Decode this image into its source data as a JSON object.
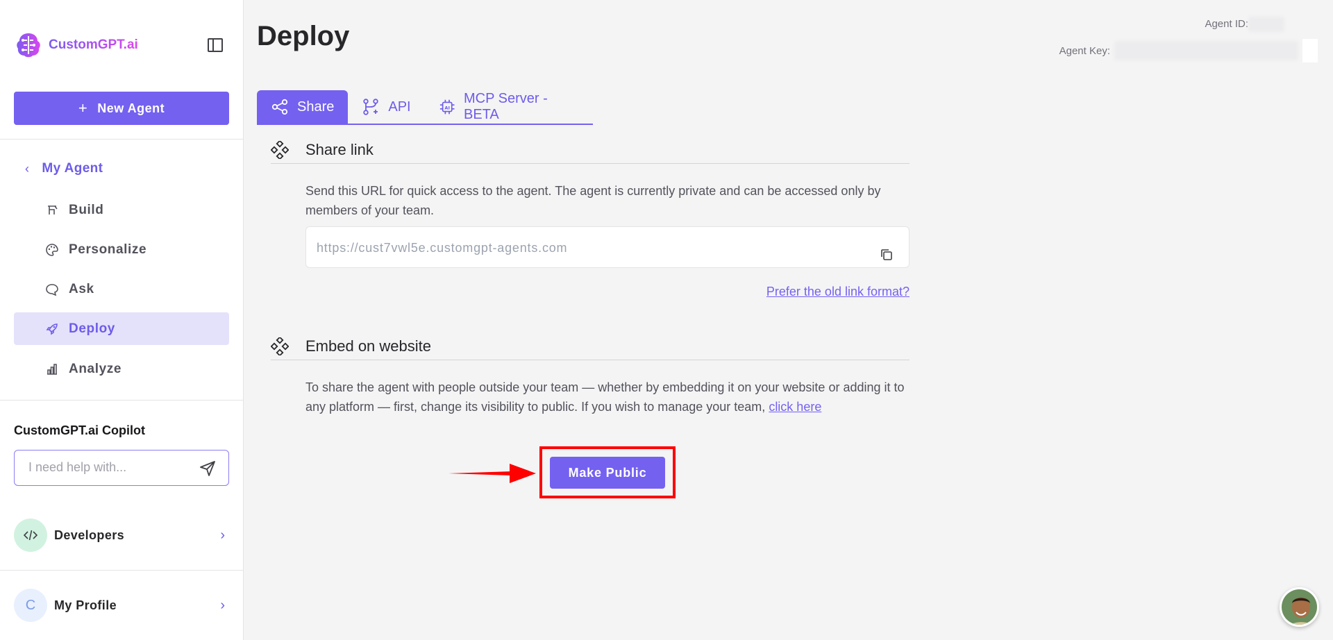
{
  "brand": {
    "name": "CustomGPT.ai"
  },
  "sidebar": {
    "new_agent_label": "New Agent",
    "back_label": "My Agent",
    "items": [
      {
        "label": "Build",
        "icon": "build-icon"
      },
      {
        "label": "Personalize",
        "icon": "palette-icon"
      },
      {
        "label": "Ask",
        "icon": "chat-icon"
      },
      {
        "label": "Deploy",
        "icon": "rocket-icon",
        "active": true
      },
      {
        "label": "Analyze",
        "icon": "chart-icon"
      }
    ],
    "copilot": {
      "title": "CustomGPT.ai Copilot",
      "placeholder": "I need help with..."
    },
    "developers_label": "Developers",
    "profile_label": "My Profile",
    "profile_initial": "C"
  },
  "header": {
    "title": "Deploy",
    "agent_id_label": "Agent ID:",
    "agent_key_label": "Agent Key:"
  },
  "tabs": [
    {
      "label": "Share",
      "icon": "share-icon",
      "active": true
    },
    {
      "label": "API",
      "icon": "api-icon"
    },
    {
      "label": "MCP Server - BETA",
      "icon": "chip-icon"
    }
  ],
  "share_link": {
    "title": "Share link",
    "description": "Send this URL for quick access to the agent. The agent is currently private and can be accessed only by members of your team.",
    "url": "https://cust7vwl5e.customgpt-agents.com",
    "old_format_link": "Prefer the old link format?"
  },
  "embed": {
    "title": "Embed on website",
    "description": "To share the agent with people outside your team — whether by embedding it on your website or adding it to any platform — first, change its visibility to public. If you wish to manage your team,",
    "link_text": "click here",
    "button_label": "Make Public"
  },
  "colors": {
    "accent": "#7461f0",
    "annotation": "#ff0000"
  }
}
